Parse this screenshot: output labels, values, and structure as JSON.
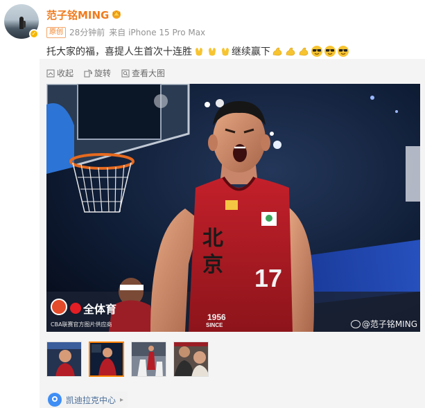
{
  "post": {
    "author": "范子铭MING",
    "original_tag": "原创",
    "time": "28分钟前",
    "source": "来自 iPhone 15 Pro Max",
    "text_part1": "托大家的福，喜提人生首次十连胜",
    "text_part2": "继续赢下",
    "emojis": [
      "hands-icon",
      "flexed-biceps-icon",
      "cool-face-icon"
    ]
  },
  "toolbar": {
    "collapse_label": "收起",
    "rotate_label": "旋转",
    "view_large_label": "查看大图"
  },
  "photo": {
    "jersey_text": "北京",
    "jersey_number": "17",
    "jersey_year": "1956",
    "jersey_since": "SINCE",
    "watermark_brand": "全体育",
    "watermark_caption": "CBA联赛官方图片供应商",
    "watermark_user": "@范子铭MING"
  },
  "thumbnails": {
    "count": 4,
    "active_index": 1
  },
  "location": {
    "name": "凯迪拉克中心"
  },
  "colors": {
    "username": "#f07c1e",
    "link": "#4a6d99",
    "active_border": "#ff8200"
  }
}
